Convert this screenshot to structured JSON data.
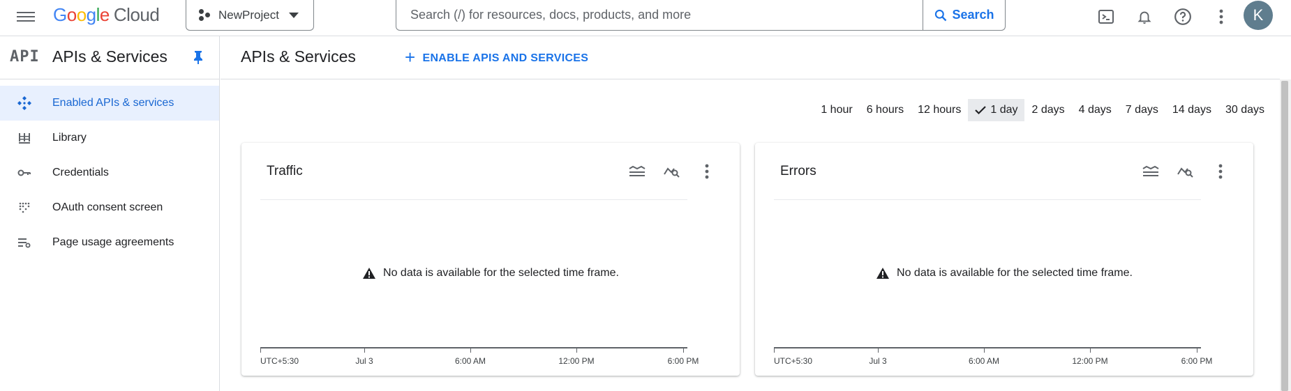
{
  "topbar": {
    "logo_google": [
      "G",
      "o",
      "o",
      "g",
      "l",
      "e"
    ],
    "logo_cloud": "Cloud",
    "project": "NewProject",
    "search_placeholder": "Search (/) for resources, docs, products, and more",
    "search_button": "Search",
    "avatar_initial": "K"
  },
  "sidebar": {
    "logo_text": "API",
    "title": "APIs & Services",
    "items": [
      {
        "label": "Enabled APIs & services",
        "icon": "enabled-apis-icon",
        "active": true
      },
      {
        "label": "Library",
        "icon": "library-icon",
        "active": false
      },
      {
        "label": "Credentials",
        "icon": "key-icon",
        "active": false
      },
      {
        "label": "OAuth consent screen",
        "icon": "oauth-consent-icon",
        "active": false
      },
      {
        "label": "Page usage agreements",
        "icon": "settings-list-icon",
        "active": false
      }
    ]
  },
  "main": {
    "title": "APIs & Services",
    "enable_button": "ENABLE APIS AND SERVICES",
    "time_ranges": [
      "1 hour",
      "6 hours",
      "12 hours",
      "1 day",
      "2 days",
      "4 days",
      "7 days",
      "14 days",
      "30 days"
    ],
    "selected_range": "1 day",
    "cards": [
      {
        "title": "Traffic",
        "message": "No data is available for the selected time frame.",
        "axis_labels": [
          "UTC+5:30",
          "Jul 3",
          "6:00 AM",
          "12:00 PM",
          "6:00 PM"
        ]
      },
      {
        "title": "Errors",
        "message": "No data is available for the selected time frame.",
        "axis_labels": [
          "UTC+5:30",
          "Jul 3",
          "6:00 AM",
          "12:00 PM",
          "6:00 PM"
        ]
      }
    ]
  },
  "colors": {
    "accent": "#1a73e8",
    "active_bg": "#e8f0fe",
    "selected_range_bg": "#e8eaed"
  }
}
